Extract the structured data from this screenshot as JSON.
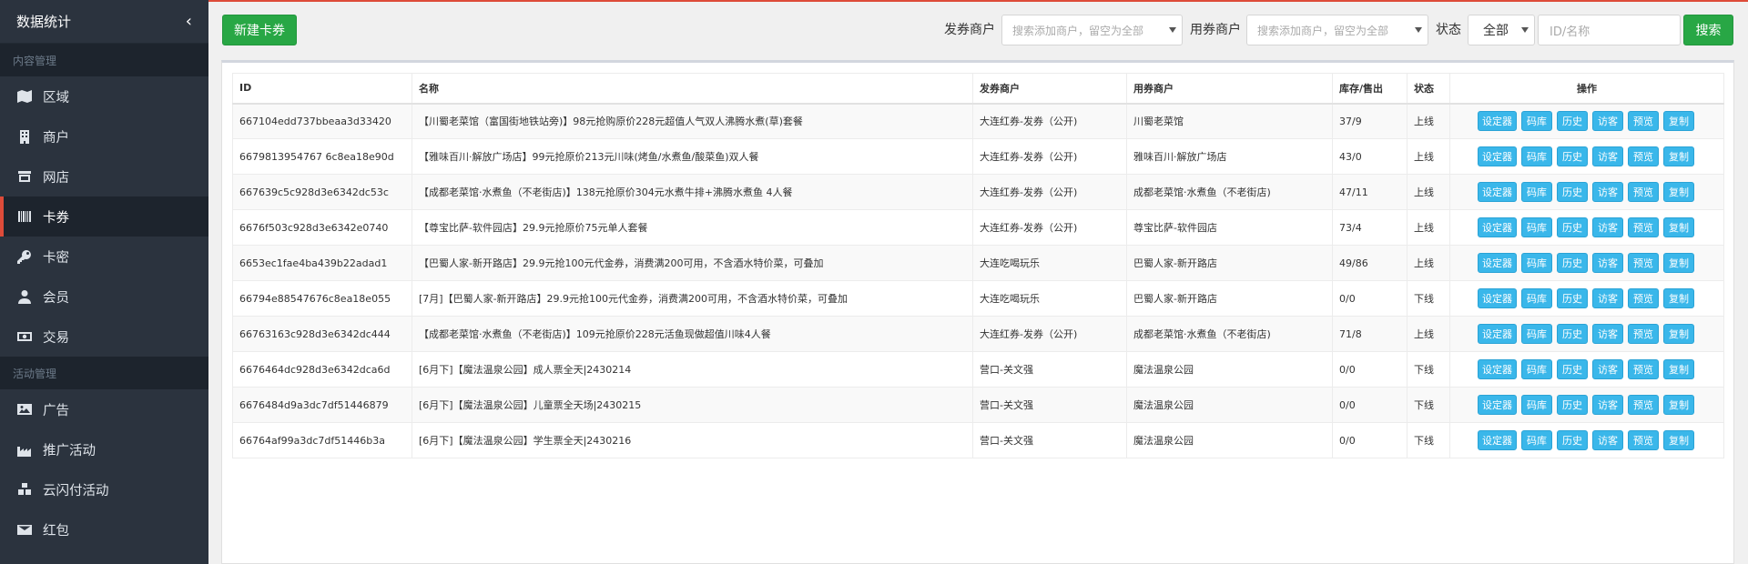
{
  "sidebar": {
    "title": "数据统计",
    "sections": [
      {
        "label": "内容管理",
        "items": [
          {
            "label": "区域",
            "icon": "map-icon"
          },
          {
            "label": "商户",
            "icon": "building-icon"
          },
          {
            "label": "网店",
            "icon": "store-icon"
          },
          {
            "label": "卡券",
            "icon": "barcode-icon",
            "active": true
          },
          {
            "label": "卡密",
            "icon": "key-icon"
          },
          {
            "label": "会员",
            "icon": "user-icon"
          },
          {
            "label": "交易",
            "icon": "money-icon"
          }
        ]
      },
      {
        "label": "活动管理",
        "items": [
          {
            "label": "广告",
            "icon": "image-icon"
          },
          {
            "label": "推广活动",
            "icon": "industry-icon"
          },
          {
            "label": "云闪付活动",
            "icon": "cubes-icon"
          },
          {
            "label": "红包",
            "icon": "envelope-icon"
          }
        ]
      }
    ]
  },
  "toolbar": {
    "new_button": "新建卡券",
    "issuer_label": "发券商户",
    "issuer_placeholder": "搜索添加商户，留空为全部",
    "user_label": "用券商户",
    "user_placeholder": "搜索添加商户，留空为全部",
    "status_label": "状态",
    "status_value": "全部",
    "id_placeholder": "ID/名称",
    "search_button": "搜索"
  },
  "table": {
    "columns": [
      "ID",
      "名称",
      "发券商户",
      "用券商户",
      "库存/售出",
      "状态",
      "操作"
    ],
    "actions": [
      "设定器",
      "码库",
      "历史",
      "访客",
      "预览",
      "复制"
    ],
    "rows": [
      {
        "id": "667104edd737bbeaa3d33420",
        "name": "【川蜀老菜馆（富国街地铁站旁)】98元抢购原价228元超值人气双人沸腾水煮(草)套餐",
        "issuer": "大连红券-发券（公开)",
        "user": "川蜀老菜馆",
        "stock": "37/9",
        "status": "上线"
      },
      {
        "id": "6679813954767 6c8ea18e90d",
        "name": "【雅味百川·解放广场店】99元抢原价213元川味(烤鱼/水煮鱼/酸菜鱼)双人餐",
        "issuer": "大连红券-发券（公开)",
        "user": "雅味百川·解放广场店",
        "stock": "43/0",
        "status": "上线"
      },
      {
        "id": "667639c5c928d3e6342dc53c",
        "name": "【成都老菜馆·水煮鱼（不老街店)】138元抢原价304元水煮牛排+沸腾水煮鱼 4人餐",
        "issuer": "大连红券-发券（公开)",
        "user": "成都老菜馆·水煮鱼（不老街店)",
        "stock": "47/11",
        "status": "上线"
      },
      {
        "id": "6676f503c928d3e6342e0740",
        "name": "【尊宝比萨-软件园店】29.9元抢原价75元单人套餐",
        "issuer": "大连红券-发券（公开)",
        "user": "尊宝比萨-软件园店",
        "stock": "73/4",
        "status": "上线"
      },
      {
        "id": "6653ec1fae4ba439b22adad1",
        "name": "【巴蜀人家-新开路店】29.9元抢100元代金券，消费满200可用，不含酒水特价菜，可叠加",
        "issuer": "大连吃喝玩乐",
        "user": "巴蜀人家-新开路店",
        "stock": "49/86",
        "status": "上线"
      },
      {
        "id": "66794e88547676c8ea18e055",
        "name": "[7月]【巴蜀人家-新开路店】29.9元抢100元代金券，消费满200可用，不含酒水特价菜，可叠加",
        "issuer": "大连吃喝玩乐",
        "user": "巴蜀人家-新开路店",
        "stock": "0/0",
        "status": "下线"
      },
      {
        "id": "66763163c928d3e6342dc444",
        "name": "【成都老菜馆·水煮鱼（不老街店)】109元抢原价228元活鱼现做超值川味4人餐",
        "issuer": "大连红券-发券（公开)",
        "user": "成都老菜馆·水煮鱼（不老街店)",
        "stock": "71/8",
        "status": "上线"
      },
      {
        "id": "6676464dc928d3e6342dca6d",
        "name": "[6月下]【魔法温泉公园】成人票全天|2430214",
        "issuer": "营口-关文强",
        "user": "魔法温泉公园",
        "stock": "0/0",
        "status": "下线"
      },
      {
        "id": "6676484d9a3dc7df51446879",
        "name": "[6月下]【魔法温泉公园】儿童票全天场|2430215",
        "issuer": "营口-关文强",
        "user": "魔法温泉公园",
        "stock": "0/0",
        "status": "下线"
      },
      {
        "id": "66764af99a3dc7df51446b3a",
        "name": "[6月下]【魔法温泉公园】学生票全天|2430216",
        "issuer": "营口-关文强",
        "user": "魔法温泉公园",
        "stock": "0/0",
        "status": "下线"
      }
    ]
  }
}
